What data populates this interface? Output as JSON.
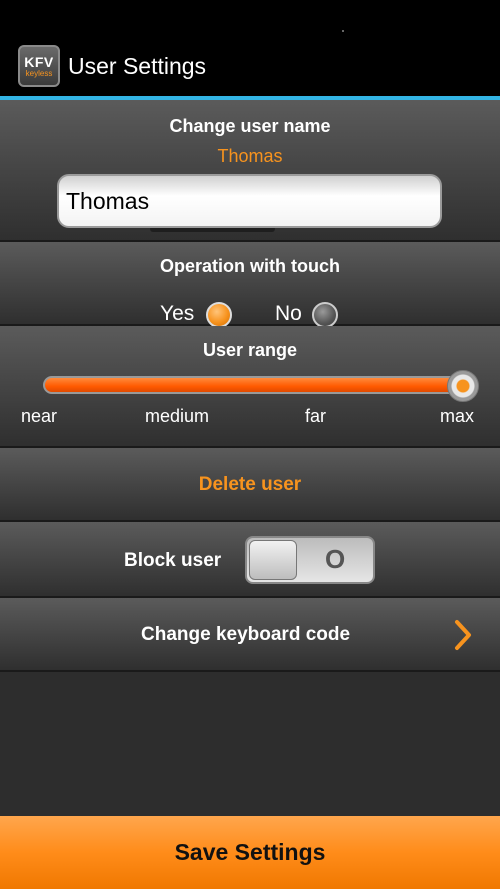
{
  "app": {
    "title": "User Settings",
    "logo_text": "KFV",
    "logo_subtext": "keyless"
  },
  "username": {
    "title": "Change user name",
    "current_value": "Thomas",
    "input_value": "Thomas"
  },
  "touch": {
    "title": "Operation with touch",
    "yes_label": "Yes",
    "no_label": "No",
    "selected": "Yes"
  },
  "range": {
    "title": "User range",
    "ticks": [
      "near",
      "medium",
      "far",
      "max"
    ],
    "selected": "max",
    "level_fraction": 1.0
  },
  "delete": {
    "label": "Delete user"
  },
  "block": {
    "label": "Block user",
    "toggle_state_text": "O",
    "enabled": false
  },
  "keyboard": {
    "label": "Change keyboard code",
    "icon": "chevron-right-icon"
  },
  "save": {
    "label": "Save Settings"
  },
  "colors": {
    "accent": "#f7931e",
    "divider_blue": "#33b5e5",
    "slider_fill": "#ff5a00"
  }
}
